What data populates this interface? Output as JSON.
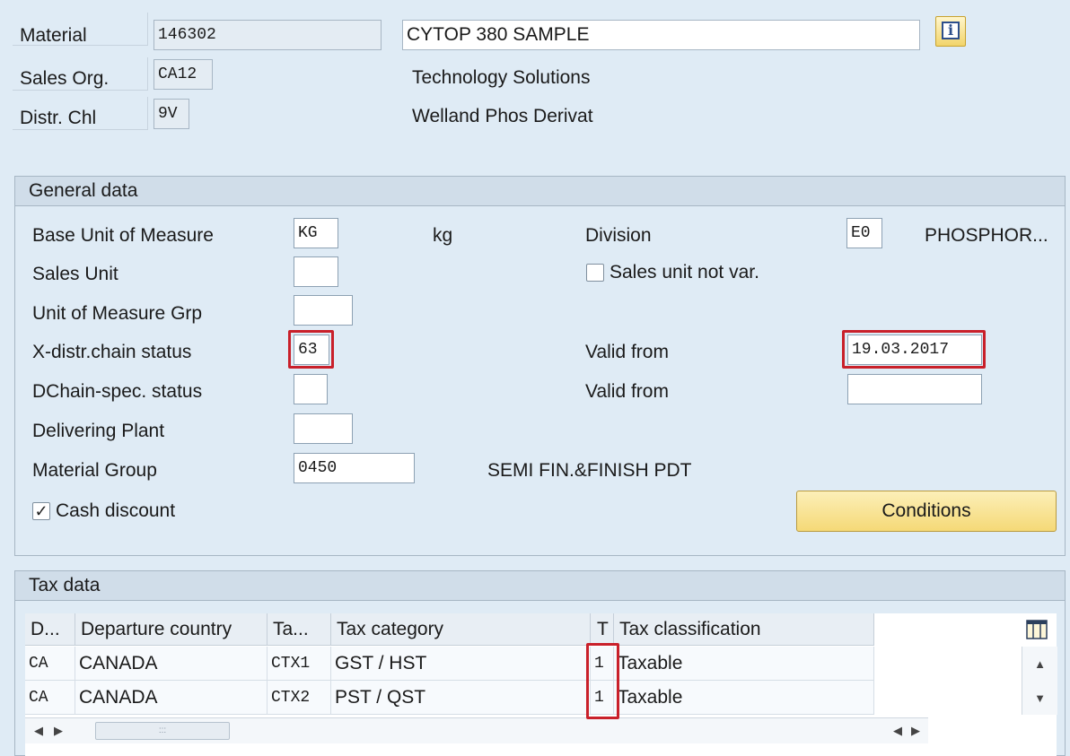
{
  "header": {
    "material_label": "Material",
    "material_value": "146302",
    "material_desc": "CYTOP 380 SAMPLE",
    "sales_org_label": "Sales Org.",
    "sales_org_value": "CA12",
    "sales_org_desc": "Technology Solutions",
    "distr_chl_label": "Distr. Chl",
    "distr_chl_value": "9V",
    "distr_chl_desc": "Welland Phos Derivat",
    "info_icon": "info-icon"
  },
  "general": {
    "title": "General data",
    "base_uom_label": "Base Unit of Measure",
    "base_uom_value": "KG",
    "base_uom_text": "kg",
    "division_label": "Division",
    "division_value": "E0",
    "division_text": "PHOSPHOR...",
    "sales_unit_label": "Sales Unit",
    "sales_unit_value": "",
    "sales_unit_not_var_label": "Sales unit not var.",
    "uom_grp_label": "Unit of Measure Grp",
    "uom_grp_value": "",
    "xdistr_label": "X-distr.chain status",
    "xdistr_value": "63",
    "valid_from_label": "Valid from",
    "valid_from_value": "19.03.2017",
    "dchain_label": "DChain-spec. status",
    "dchain_value": "",
    "valid_from2_label": "Valid from",
    "valid_from2_value": "",
    "deliv_plant_label": "Delivering Plant",
    "deliv_plant_value": "",
    "mat_group_label": "Material Group",
    "mat_group_value": "0450",
    "mat_group_text": "SEMI FIN.&FINISH PDT",
    "cash_discount_label": "Cash discount",
    "conditions_label": "Conditions"
  },
  "tax": {
    "title": "Tax data",
    "columns": [
      "D...",
      "Departure country",
      "Ta...",
      "Tax category",
      "T",
      "Tax classification"
    ],
    "rows": [
      [
        "CA",
        "CANADA",
        "CTX1",
        "GST / HST",
        "1",
        "Taxable"
      ],
      [
        "CA",
        "CANADA",
        "CTX2",
        "PST / QST",
        "1",
        "Taxable"
      ]
    ],
    "layout_icon": "table-settings-icon",
    "scroll_grip": ":::"
  },
  "colors": {
    "background": "#dfebf5",
    "highlight": "#c9202a",
    "button_yellow": "#f5d977"
  }
}
